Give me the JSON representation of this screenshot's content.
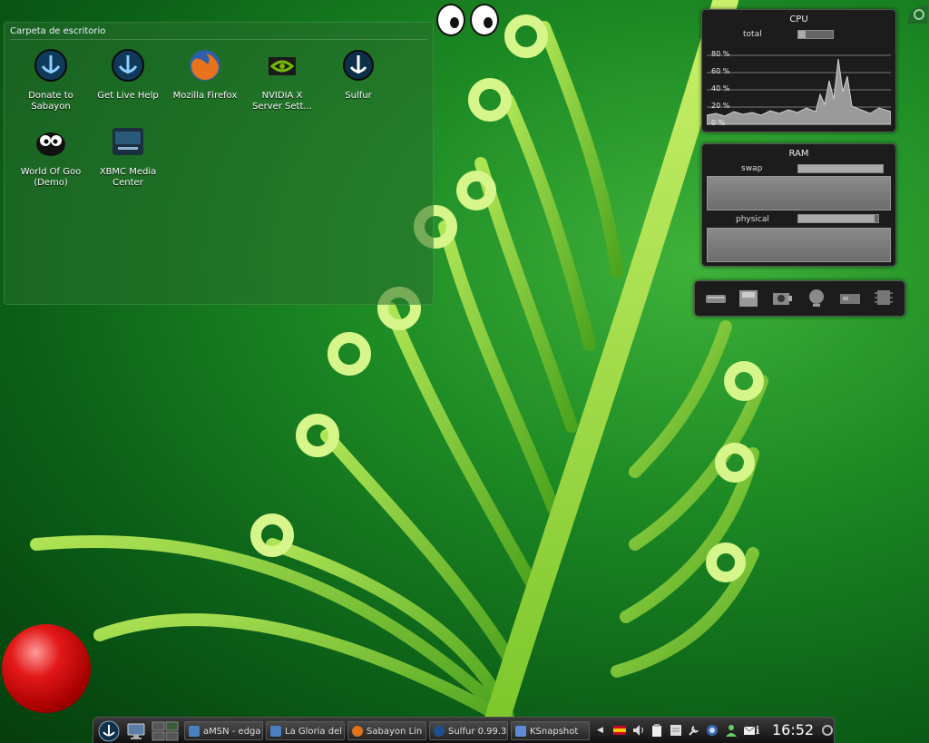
{
  "folder": {
    "title": "Carpeta de escritorio",
    "icons": [
      {
        "label_line1": "Donate to",
        "label_line2": "Sabayon",
        "icon": "sabayon-icon"
      },
      {
        "label_line1": "Get Live Help",
        "label_line2": "",
        "icon": "sabayon-help-icon"
      },
      {
        "label_line1": "Mozilla Firefox",
        "label_line2": "",
        "icon": "firefox-icon"
      },
      {
        "label_line1": "NVIDIA X",
        "label_line2": "Server Sett...",
        "icon": "nvidia-icon"
      },
      {
        "label_line1": "Sulfur",
        "label_line2": "",
        "icon": "sulfur-icon"
      },
      {
        "label_line1": "World Of Goo",
        "label_line2": "(Demo)",
        "icon": "world-of-goo-icon"
      },
      {
        "label_line1": "XBMC Media",
        "label_line2": "Center",
        "icon": "xbmc-icon"
      }
    ]
  },
  "cpu": {
    "title": "CPU",
    "total_label": "total",
    "total_usage": 0.2,
    "ticks": [
      "80 %",
      "60 %",
      "40 %",
      "20 %",
      "0 %"
    ]
  },
  "ram": {
    "title": "RAM",
    "swap_label": "swap",
    "swap_usage": 1.0,
    "physical_label": "physical",
    "physical_usage": 0.95
  },
  "taskbar": {
    "tasks": [
      {
        "label": "aMSN - edga",
        "icon": "amsn-icon",
        "color": "#4a7fc0"
      },
      {
        "label": "La Gloria del",
        "icon": "amsn-chat-icon",
        "color": "#4a7fc0"
      },
      {
        "label": "Sabayon Lin",
        "icon": "firefox-icon",
        "color": "#e0731c"
      },
      {
        "label": "Sulfur 0.99.3",
        "icon": "sulfur-icon",
        "color": "#1e4f8f"
      },
      {
        "label": "KSnapshot",
        "icon": "ksnapshot-icon",
        "color": "#5d8bd6"
      }
    ],
    "clock": "16:52"
  }
}
